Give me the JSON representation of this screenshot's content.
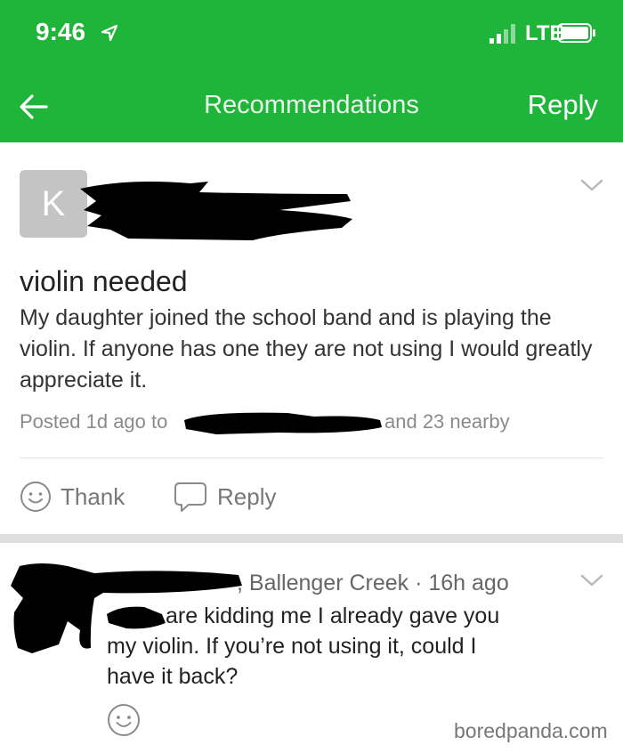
{
  "status_bar": {
    "time": "9:46",
    "network": "LTE"
  },
  "nav": {
    "title": "Recommendations",
    "reply_label": "Reply"
  },
  "post": {
    "avatar_letter": "K",
    "title": "violin needed",
    "body": "My daughter joined the school band and is playing the violin. If anyone has one they are not using I would greatly appreciate it.",
    "posted_prefix": "Posted 1d ago to",
    "posted_suffix": "and 23 nearby"
  },
  "actions": {
    "thank_label": "Thank",
    "reply_label": "Reply"
  },
  "comment": {
    "meta": ", Ballenger Creek · 16h ago",
    "line1": "are kidding me I already gave you",
    "line2": "my violin. If you’re not using it, could I",
    "line3": "have it back?"
  },
  "watermark": "boredpanda.com",
  "colors": {
    "brand_green": "#1fb43a",
    "redaction": "#000000"
  },
  "icons": {
    "back": "arrow-left-icon",
    "chevron": "chevron-down-icon",
    "thank": "smiley-icon",
    "reply": "speech-bubble-icon"
  }
}
